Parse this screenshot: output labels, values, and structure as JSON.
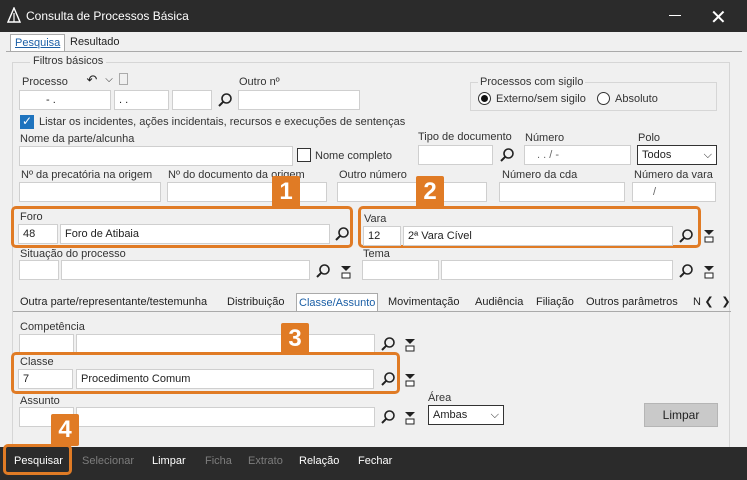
{
  "window": {
    "title": "Consulta de Processos Básica"
  },
  "tabs_top": [
    {
      "label": "Pesquisa"
    },
    {
      "label": "Resultado"
    }
  ],
  "filters": {
    "group_label": "Filtros básicos",
    "processo_label": "Processo",
    "processo_p1": "- .",
    "processo_p2": ". .",
    "outro_n_label": "Outro nº",
    "sigilo_group": "Processos com sigilo",
    "sigilo_opt1": "Externo/sem sigilo",
    "sigilo_opt2": "Absoluto",
    "listar_label": "Listar os incidentes, ações incidentais, recursos e execuções de sentenças",
    "nome_parte_label": "Nome da parte/alcunha",
    "nome_completo_label": "Nome completo",
    "tipo_doc_label": "Tipo de documento",
    "numero_label": "Número",
    "numero_value": ". . /  -",
    "polo_label": "Polo",
    "polo_value": "Todos",
    "precatoria_label": "Nº da precatória na origem",
    "doc_origem_label": "Nº do documento da origem",
    "outro_numero_label": "Outro número",
    "cda_label": "Número da cda",
    "vara_num_label": "Número da vara",
    "vara_num_value": "/"
  },
  "foro": {
    "label": "Foro",
    "code": "48",
    "name": "Foro de Atibaia"
  },
  "vara": {
    "label": "Vara",
    "code": "12",
    "name": "2ª Vara Cível"
  },
  "situacao_label": "Situação do processo",
  "tema_label": "Tema",
  "subtabs": [
    {
      "label": "Outra parte/representante/testemunha"
    },
    {
      "label": "Distribuição"
    },
    {
      "label": "Classe/Assunto"
    },
    {
      "label": "Movimentação"
    },
    {
      "label": "Audiência"
    },
    {
      "label": "Filiação"
    },
    {
      "label": "Outros parâmetros"
    },
    {
      "label": "N"
    }
  ],
  "classe_assunto": {
    "competencia_label": "Competência",
    "classe_label": "Classe",
    "classe_code": "7",
    "classe_name": "Procedimento Comum",
    "assunto_label": "Assunto",
    "area_label": "Área",
    "area_value": "Ambas",
    "limpar_button": "Limpar"
  },
  "badges": [
    "1",
    "2",
    "3",
    "4"
  ],
  "bottom_bar": {
    "pesquisar": "Pesquisar",
    "selecionar": "Selecionar",
    "limpar": "Limpar",
    "ficha": "Ficha",
    "extrato": "Extrato",
    "relacao": "Relação",
    "fechar": "Fechar"
  },
  "colors": {
    "accent": "#e07b25",
    "titlebar": "#2b2b2b",
    "link": "#1b5fa6"
  }
}
